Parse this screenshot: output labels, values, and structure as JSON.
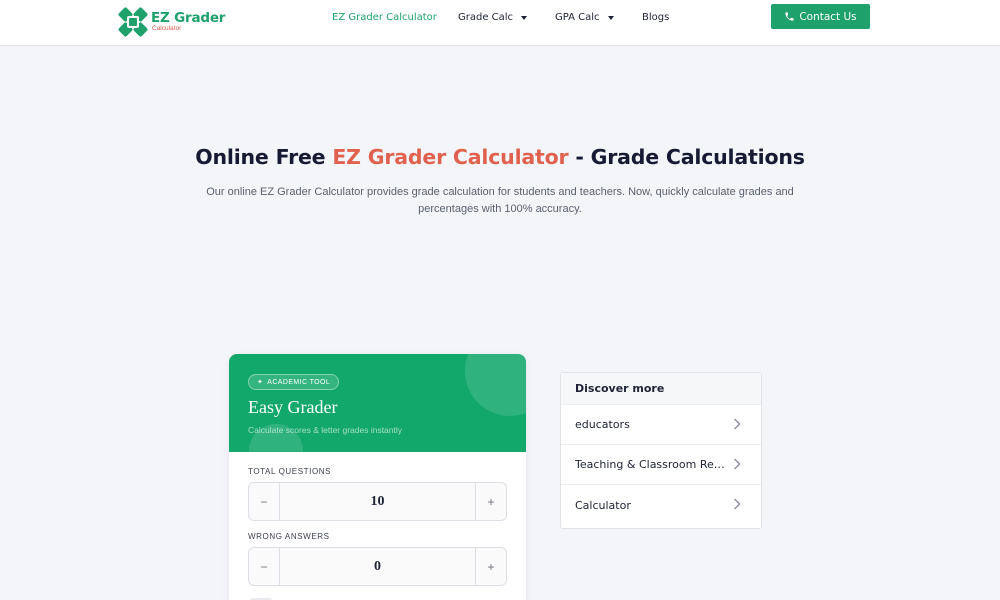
{
  "brand": {
    "title": "EZ Grader",
    "subtitle": "Calculator",
    "accent_color": "#1ea16a",
    "secondary_color": "#e0624e"
  },
  "nav": {
    "items": [
      {
        "label": "EZ Grader Calculator",
        "active": true
      },
      {
        "label": "Grade Calc",
        "dropdown": true
      },
      {
        "label": "GPA Calc",
        "dropdown": true
      },
      {
        "label": "Blogs"
      }
    ],
    "contact_label": "Contact Us",
    "contact_icon": "phone-icon"
  },
  "hero": {
    "title_pre": "Online Free ",
    "title_accent": "EZ Grader Calculator",
    "title_post": " - Grade Calculations",
    "description": "Our online EZ Grader Calculator provides grade calculation for students and teachers. Now, quickly calculate grades and percentages with 100% accuracy."
  },
  "calculator": {
    "badge": "ACADEMIC TOOL",
    "badge_icon": "sparkle-icon",
    "title": "Easy Grader",
    "subtitle": "Calculate scores & letter grades instantly",
    "fields": [
      {
        "label": "TOTAL QUESTIONS",
        "value": "10"
      },
      {
        "label": "WRONG ANSWERS",
        "value": "0"
      }
    ],
    "minus_symbol": "−",
    "plus_symbol": "+"
  },
  "discover": {
    "title": "Discover more",
    "items": [
      {
        "label": "educators"
      },
      {
        "label": "Teaching & Classroom Resources"
      },
      {
        "label": "Calculator"
      }
    ]
  }
}
